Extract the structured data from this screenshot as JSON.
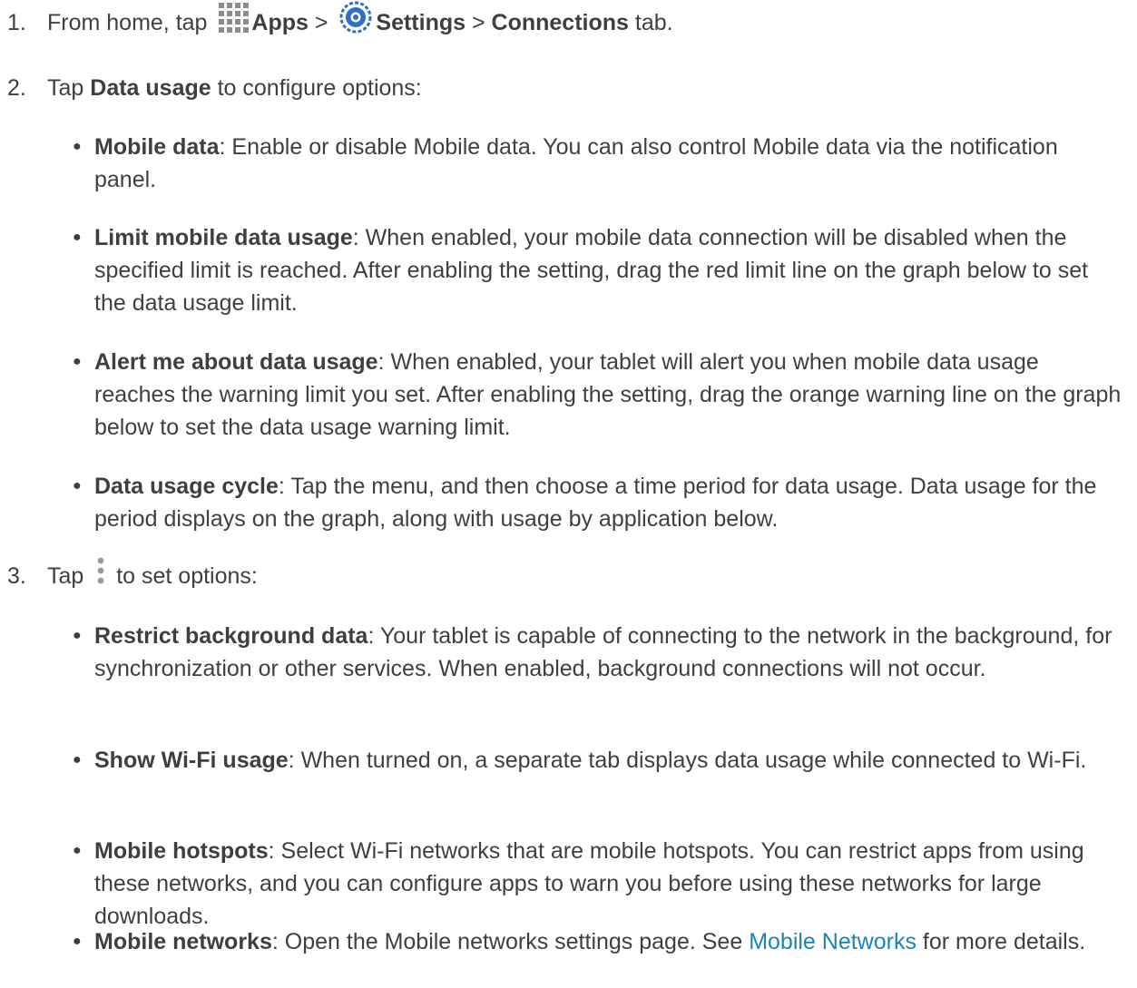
{
  "steps": [
    {
      "num": "1.",
      "p1": "From home, tap ",
      "apps_label": "Apps",
      "sep1": " > ",
      "settings_label": "Settings",
      "sep2": " > ",
      "connections_label": "Connections",
      "tail": " tab.",
      "apps_icon": "apps-grid-icon",
      "settings_icon": "settings-gear-icon"
    },
    {
      "num": "2.",
      "p1": "Tap ",
      "bold": "Data usage",
      "tail": " to configure options:"
    },
    {
      "num": "3.",
      "p1": "Tap ",
      "tail": " to set options:",
      "menu_icon": "more-options-icon"
    }
  ],
  "bullets": [
    {
      "term": "Mobile data",
      "text": ": Enable or disable Mobile data. You can also control Mobile data via the notification panel."
    },
    {
      "term": "Limit mobile data usage",
      "text": ": When enabled, your mobile data connection will be disabled when the specified limit is reached. After enabling the setting, drag the red limit line on the graph below to set the data usage limit."
    },
    {
      "term": "Alert me about data usage",
      "text": ": When enabled, your tablet will alert you when mobile data usage reaches the warning limit you set. After enabling the setting, drag the orange warning line on the graph below to set the data usage warning limit."
    },
    {
      "term": "Data usage cycle",
      "text": ": Tap the menu, and then choose a time period for data usage. Data usage for the period displays on the graph, along with usage by application below."
    },
    {
      "term": "Restrict background data",
      "text": ": Your tablet is capable of connecting to the network in the background, for synchronization or other services. When enabled, background connections will not occur."
    },
    {
      "term": "Show Wi-Fi usage",
      "text": ": When turned on, a separate tab displays data usage while connected to Wi-Fi."
    },
    {
      "term": "Mobile hotspots",
      "text": ": Select Wi-Fi networks that are mobile hotspots. You can restrict apps from using these networks, and you can configure apps to warn you before using these networks for large downloads."
    },
    {
      "term": "Mobile networks",
      "text": ": Open the Mobile networks settings page. See ",
      "link": "Mobile Networks",
      "tail": " for more details."
    }
  ],
  "colors": {
    "text": "#3f3f3f",
    "link": "#1a86b8",
    "settings_icon": "#2d6fc4"
  }
}
